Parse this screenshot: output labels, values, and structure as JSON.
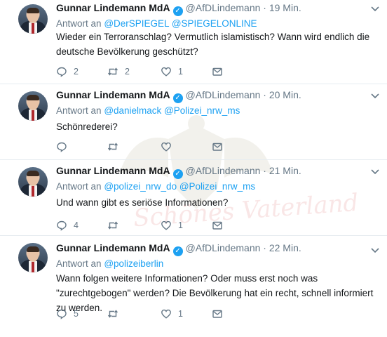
{
  "colors": {
    "accent": "#1da1f2",
    "text": "#14171a",
    "muted": "#657786",
    "divider": "#e6ecf0"
  },
  "watermark_text": "Schönes Vaterland",
  "tweets": [
    {
      "name": "Gunnar Lindemann MdA",
      "handle": "@AfDLindemann",
      "time": "19 Min.",
      "reply_prefix": "Antwort an",
      "mentions": [
        "@DerSPIEGEL",
        "@SPIEGELONLINE"
      ],
      "text": "Wieder ein Terroranschlag? Vermutlich islamistisch? Wann wird endlich die deutsche Bevölkerung geschützt?",
      "replies": "2",
      "retweets": "2",
      "likes": "1"
    },
    {
      "name": "Gunnar Lindemann MdA",
      "handle": "@AfDLindemann",
      "time": "20 Min.",
      "reply_prefix": "Antwort an",
      "mentions": [
        "@danielmack",
        "@Polizei_nrw_ms"
      ],
      "text": "Schönrederei?",
      "replies": "",
      "retweets": "",
      "likes": ""
    },
    {
      "name": "Gunnar Lindemann MdA",
      "handle": "@AfDLindemann",
      "time": "21 Min.",
      "reply_prefix": "Antwort an",
      "mentions": [
        "@polizei_nrw_do",
        "@Polizei_nrw_ms"
      ],
      "text": "Und wann gibt es seriöse Informationen?",
      "replies": "4",
      "retweets": "",
      "likes": "1"
    },
    {
      "name": "Gunnar Lindemann MdA",
      "handle": "@AfDLindemann",
      "time": "22 Min.",
      "reply_prefix": "Antwort an",
      "mentions": [
        "@polizeiberlin"
      ],
      "text": "Wann folgen weitere Informationen? Oder muss erst noch was \"zurechtgebogen\" werden? Die Bevölkerung hat ein recht, schnell informiert zu werden.",
      "replies": "5",
      "retweets": "",
      "likes": "1"
    }
  ],
  "icons": {
    "verified": "verified-badge-icon",
    "chevron": "chevron-down-icon",
    "reply": "reply-icon",
    "retweet": "retweet-icon",
    "like": "heart-icon",
    "dm": "direct-message-icon"
  }
}
